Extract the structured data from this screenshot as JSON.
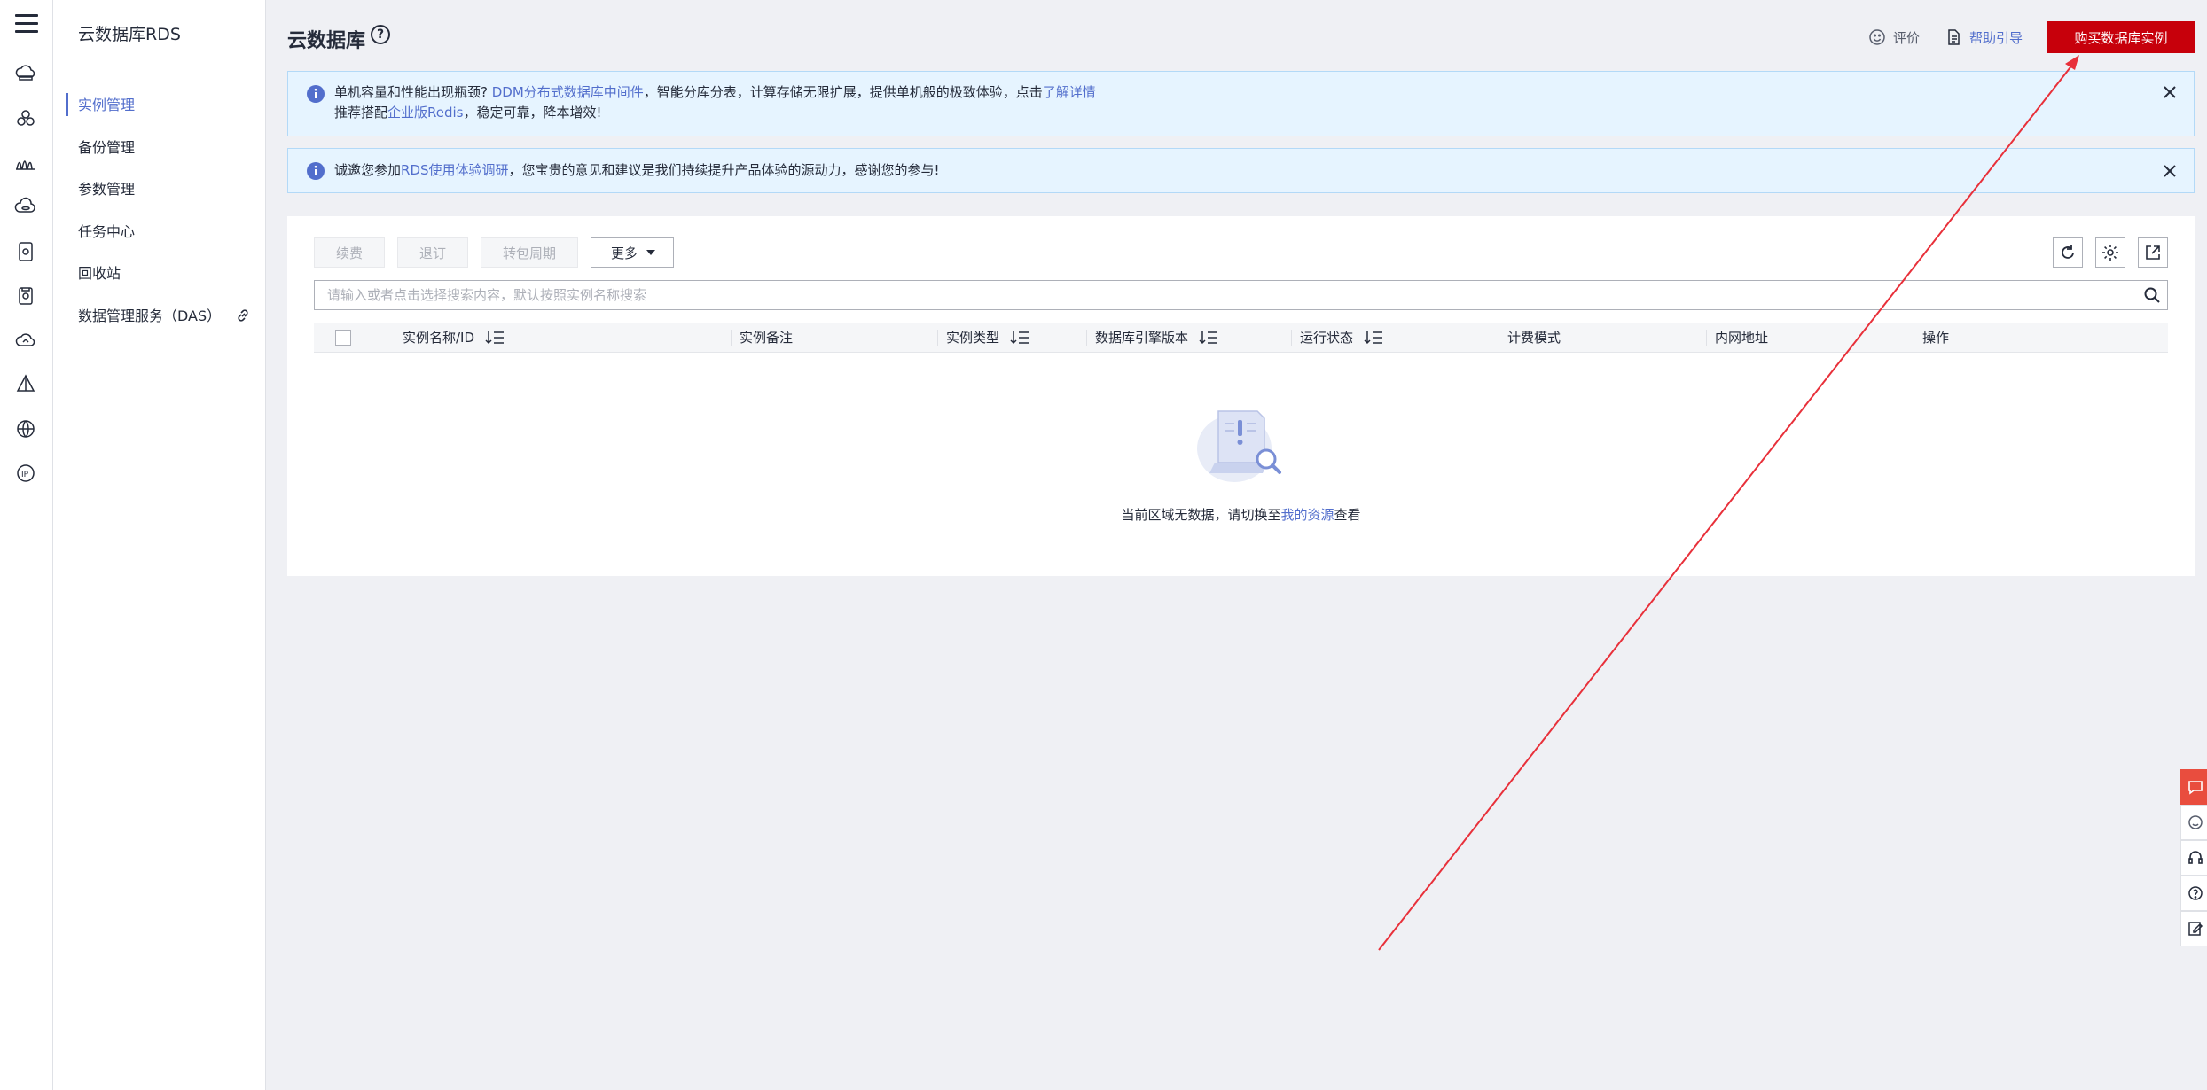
{
  "sidebar": {
    "title": "云数据库RDS",
    "items": [
      {
        "label": "实例管理",
        "active": true
      },
      {
        "label": "备份管理"
      },
      {
        "label": "参数管理"
      },
      {
        "label": "任务中心"
      },
      {
        "label": "回收站"
      },
      {
        "label": "数据管理服务（DAS）",
        "icon": "link-icon"
      }
    ]
  },
  "rail": {
    "icons": [
      "cloud-server-icon",
      "cluster-icon",
      "cdn-icon",
      "cloud-database-icon",
      "storage-icon",
      "document-icon",
      "cloud-icon",
      "network-icon",
      "globe-icon",
      "ip-icon"
    ]
  },
  "header": {
    "title": "云数据库",
    "rate_label": "评价",
    "help_label": "帮助引导",
    "buy_button": "购买数据库实例"
  },
  "notices": {
    "n1": {
      "line1_prefix": "单机容量和性能出现瓶颈? ",
      "line1_link1": "DDM分布式数据库中间件",
      "line1_mid": "，智能分库分表，计算存储无限扩展，提供单机般的极致体验，点击",
      "line1_link2": "了解详情",
      "line2_prefix": "推荐搭配",
      "line2_link": "企业版Redis",
      "line2_suffix": "，稳定可靠，降本增效!"
    },
    "n2": {
      "prefix": "诚邀您参加",
      "link": "RDS使用体验调研",
      "suffix": "，您宝贵的意见和建议是我们持续提升产品体验的源动力，感谢您的参与!"
    }
  },
  "toolbar": {
    "renew": "续费",
    "unsubscribe": "退订",
    "to_package": "转包周期",
    "more": "更多"
  },
  "search": {
    "placeholder": "请输入或者点击选择搜索内容，默认按照实例名称搜索"
  },
  "table": {
    "columns": [
      "实例名称/ID",
      "实例备注",
      "实例类型",
      "数据库引擎版本",
      "运行状态",
      "计费模式",
      "内网地址",
      "操作"
    ]
  },
  "empty": {
    "prefix": "当前区域无数据，请切换至",
    "link": "我的资源",
    "suffix": "查看"
  },
  "colors": {
    "accent": "#526ecc",
    "buy": "#c7000b",
    "annotation_arrow": "#e8303a"
  }
}
